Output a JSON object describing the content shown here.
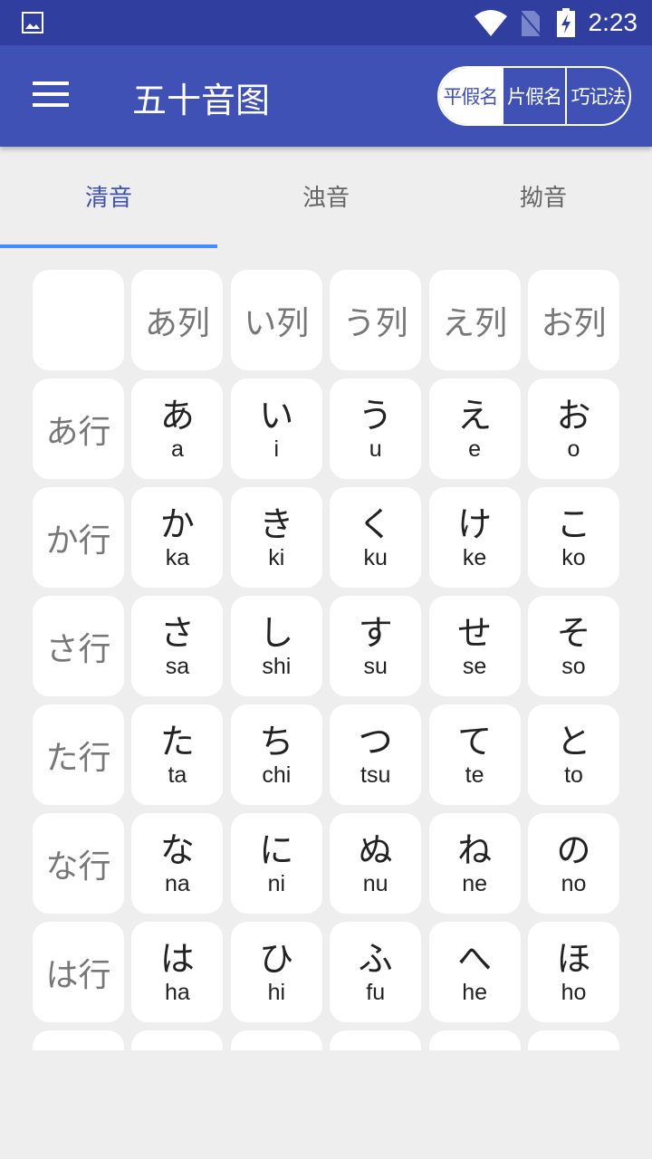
{
  "status_bar": {
    "time": "2:23",
    "icons": [
      "image-icon",
      "wifi-icon",
      "no-sim-icon",
      "battery-charging-icon"
    ]
  },
  "app_bar": {
    "title": "五十音图",
    "segments": [
      {
        "label": "平假名",
        "selected": true
      },
      {
        "label": "片假名",
        "selected": false
      },
      {
        "label": "巧记法",
        "selected": false
      }
    ]
  },
  "tabs": [
    {
      "label": "清音",
      "selected": true
    },
    {
      "label": "浊音",
      "selected": false
    },
    {
      "label": "拗音",
      "selected": false
    }
  ],
  "columns": [
    "",
    "あ列",
    "い列",
    "う列",
    "え列",
    "お列"
  ],
  "rows": [
    {
      "label": "あ行",
      "cells": [
        [
          "あ",
          "a"
        ],
        [
          "い",
          "i"
        ],
        [
          "う",
          "u"
        ],
        [
          "え",
          "e"
        ],
        [
          "お",
          "o"
        ]
      ]
    },
    {
      "label": "か行",
      "cells": [
        [
          "か",
          "ka"
        ],
        [
          "き",
          "ki"
        ],
        [
          "く",
          "ku"
        ],
        [
          "け",
          "ke"
        ],
        [
          "こ",
          "ko"
        ]
      ]
    },
    {
      "label": "さ行",
      "cells": [
        [
          "さ",
          "sa"
        ],
        [
          "し",
          "shi"
        ],
        [
          "す",
          "su"
        ],
        [
          "せ",
          "se"
        ],
        [
          "そ",
          "so"
        ]
      ]
    },
    {
      "label": "た行",
      "cells": [
        [
          "た",
          "ta"
        ],
        [
          "ち",
          "chi"
        ],
        [
          "つ",
          "tsu"
        ],
        [
          "て",
          "te"
        ],
        [
          "と",
          "to"
        ]
      ]
    },
    {
      "label": "な行",
      "cells": [
        [
          "な",
          "na"
        ],
        [
          "に",
          "ni"
        ],
        [
          "ぬ",
          "nu"
        ],
        [
          "ね",
          "ne"
        ],
        [
          "の",
          "no"
        ]
      ]
    },
    {
      "label": "は行",
      "cells": [
        [
          "は",
          "ha"
        ],
        [
          "ひ",
          "hi"
        ],
        [
          "ふ",
          "fu"
        ],
        [
          "へ",
          "he"
        ],
        [
          "ほ",
          "ho"
        ]
      ]
    },
    {
      "label": "",
      "cells": [
        [
          "",
          ""
        ],
        [
          "",
          ""
        ],
        [
          "",
          ""
        ],
        [
          "",
          ""
        ],
        [
          "",
          ""
        ]
      ]
    }
  ]
}
